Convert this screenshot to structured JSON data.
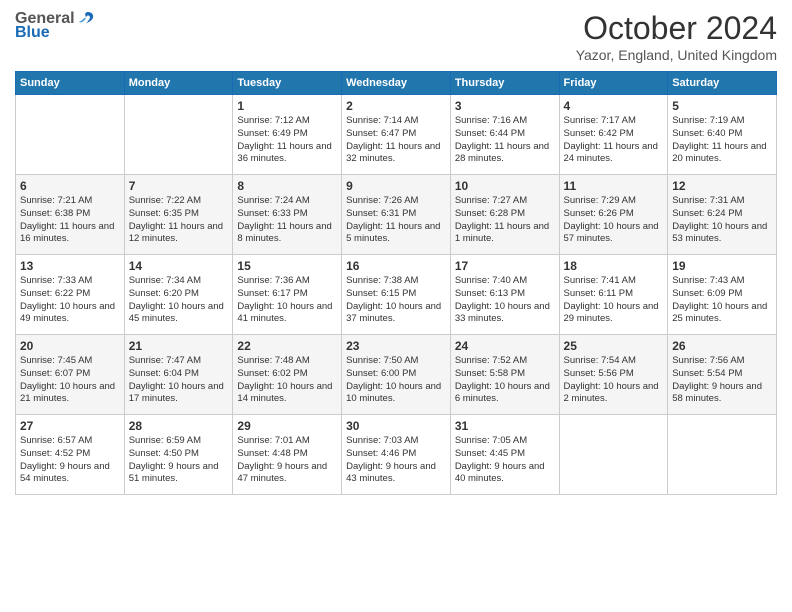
{
  "logo": {
    "general": "General",
    "blue": "Blue"
  },
  "title": "October 2024",
  "location": "Yazor, England, United Kingdom",
  "days_header": [
    "Sunday",
    "Monday",
    "Tuesday",
    "Wednesday",
    "Thursday",
    "Friday",
    "Saturday"
  ],
  "weeks": [
    [
      {
        "day": "",
        "info": ""
      },
      {
        "day": "",
        "info": ""
      },
      {
        "day": "1",
        "info": "Sunrise: 7:12 AM\nSunset: 6:49 PM\nDaylight: 11 hours and 36 minutes."
      },
      {
        "day": "2",
        "info": "Sunrise: 7:14 AM\nSunset: 6:47 PM\nDaylight: 11 hours and 32 minutes."
      },
      {
        "day": "3",
        "info": "Sunrise: 7:16 AM\nSunset: 6:44 PM\nDaylight: 11 hours and 28 minutes."
      },
      {
        "day": "4",
        "info": "Sunrise: 7:17 AM\nSunset: 6:42 PM\nDaylight: 11 hours and 24 minutes."
      },
      {
        "day": "5",
        "info": "Sunrise: 7:19 AM\nSunset: 6:40 PM\nDaylight: 11 hours and 20 minutes."
      }
    ],
    [
      {
        "day": "6",
        "info": "Sunrise: 7:21 AM\nSunset: 6:38 PM\nDaylight: 11 hours and 16 minutes."
      },
      {
        "day": "7",
        "info": "Sunrise: 7:22 AM\nSunset: 6:35 PM\nDaylight: 11 hours and 12 minutes."
      },
      {
        "day": "8",
        "info": "Sunrise: 7:24 AM\nSunset: 6:33 PM\nDaylight: 11 hours and 8 minutes."
      },
      {
        "day": "9",
        "info": "Sunrise: 7:26 AM\nSunset: 6:31 PM\nDaylight: 11 hours and 5 minutes."
      },
      {
        "day": "10",
        "info": "Sunrise: 7:27 AM\nSunset: 6:28 PM\nDaylight: 11 hours and 1 minute."
      },
      {
        "day": "11",
        "info": "Sunrise: 7:29 AM\nSunset: 6:26 PM\nDaylight: 10 hours and 57 minutes."
      },
      {
        "day": "12",
        "info": "Sunrise: 7:31 AM\nSunset: 6:24 PM\nDaylight: 10 hours and 53 minutes."
      }
    ],
    [
      {
        "day": "13",
        "info": "Sunrise: 7:33 AM\nSunset: 6:22 PM\nDaylight: 10 hours and 49 minutes."
      },
      {
        "day": "14",
        "info": "Sunrise: 7:34 AM\nSunset: 6:20 PM\nDaylight: 10 hours and 45 minutes."
      },
      {
        "day": "15",
        "info": "Sunrise: 7:36 AM\nSunset: 6:17 PM\nDaylight: 10 hours and 41 minutes."
      },
      {
        "day": "16",
        "info": "Sunrise: 7:38 AM\nSunset: 6:15 PM\nDaylight: 10 hours and 37 minutes."
      },
      {
        "day": "17",
        "info": "Sunrise: 7:40 AM\nSunset: 6:13 PM\nDaylight: 10 hours and 33 minutes."
      },
      {
        "day": "18",
        "info": "Sunrise: 7:41 AM\nSunset: 6:11 PM\nDaylight: 10 hours and 29 minutes."
      },
      {
        "day": "19",
        "info": "Sunrise: 7:43 AM\nSunset: 6:09 PM\nDaylight: 10 hours and 25 minutes."
      }
    ],
    [
      {
        "day": "20",
        "info": "Sunrise: 7:45 AM\nSunset: 6:07 PM\nDaylight: 10 hours and 21 minutes."
      },
      {
        "day": "21",
        "info": "Sunrise: 7:47 AM\nSunset: 6:04 PM\nDaylight: 10 hours and 17 minutes."
      },
      {
        "day": "22",
        "info": "Sunrise: 7:48 AM\nSunset: 6:02 PM\nDaylight: 10 hours and 14 minutes."
      },
      {
        "day": "23",
        "info": "Sunrise: 7:50 AM\nSunset: 6:00 PM\nDaylight: 10 hours and 10 minutes."
      },
      {
        "day": "24",
        "info": "Sunrise: 7:52 AM\nSunset: 5:58 PM\nDaylight: 10 hours and 6 minutes."
      },
      {
        "day": "25",
        "info": "Sunrise: 7:54 AM\nSunset: 5:56 PM\nDaylight: 10 hours and 2 minutes."
      },
      {
        "day": "26",
        "info": "Sunrise: 7:56 AM\nSunset: 5:54 PM\nDaylight: 9 hours and 58 minutes."
      }
    ],
    [
      {
        "day": "27",
        "info": "Sunrise: 6:57 AM\nSunset: 4:52 PM\nDaylight: 9 hours and 54 minutes."
      },
      {
        "day": "28",
        "info": "Sunrise: 6:59 AM\nSunset: 4:50 PM\nDaylight: 9 hours and 51 minutes."
      },
      {
        "day": "29",
        "info": "Sunrise: 7:01 AM\nSunset: 4:48 PM\nDaylight: 9 hours and 47 minutes."
      },
      {
        "day": "30",
        "info": "Sunrise: 7:03 AM\nSunset: 4:46 PM\nDaylight: 9 hours and 43 minutes."
      },
      {
        "day": "31",
        "info": "Sunrise: 7:05 AM\nSunset: 4:45 PM\nDaylight: 9 hours and 40 minutes."
      },
      {
        "day": "",
        "info": ""
      },
      {
        "day": "",
        "info": ""
      }
    ]
  ]
}
